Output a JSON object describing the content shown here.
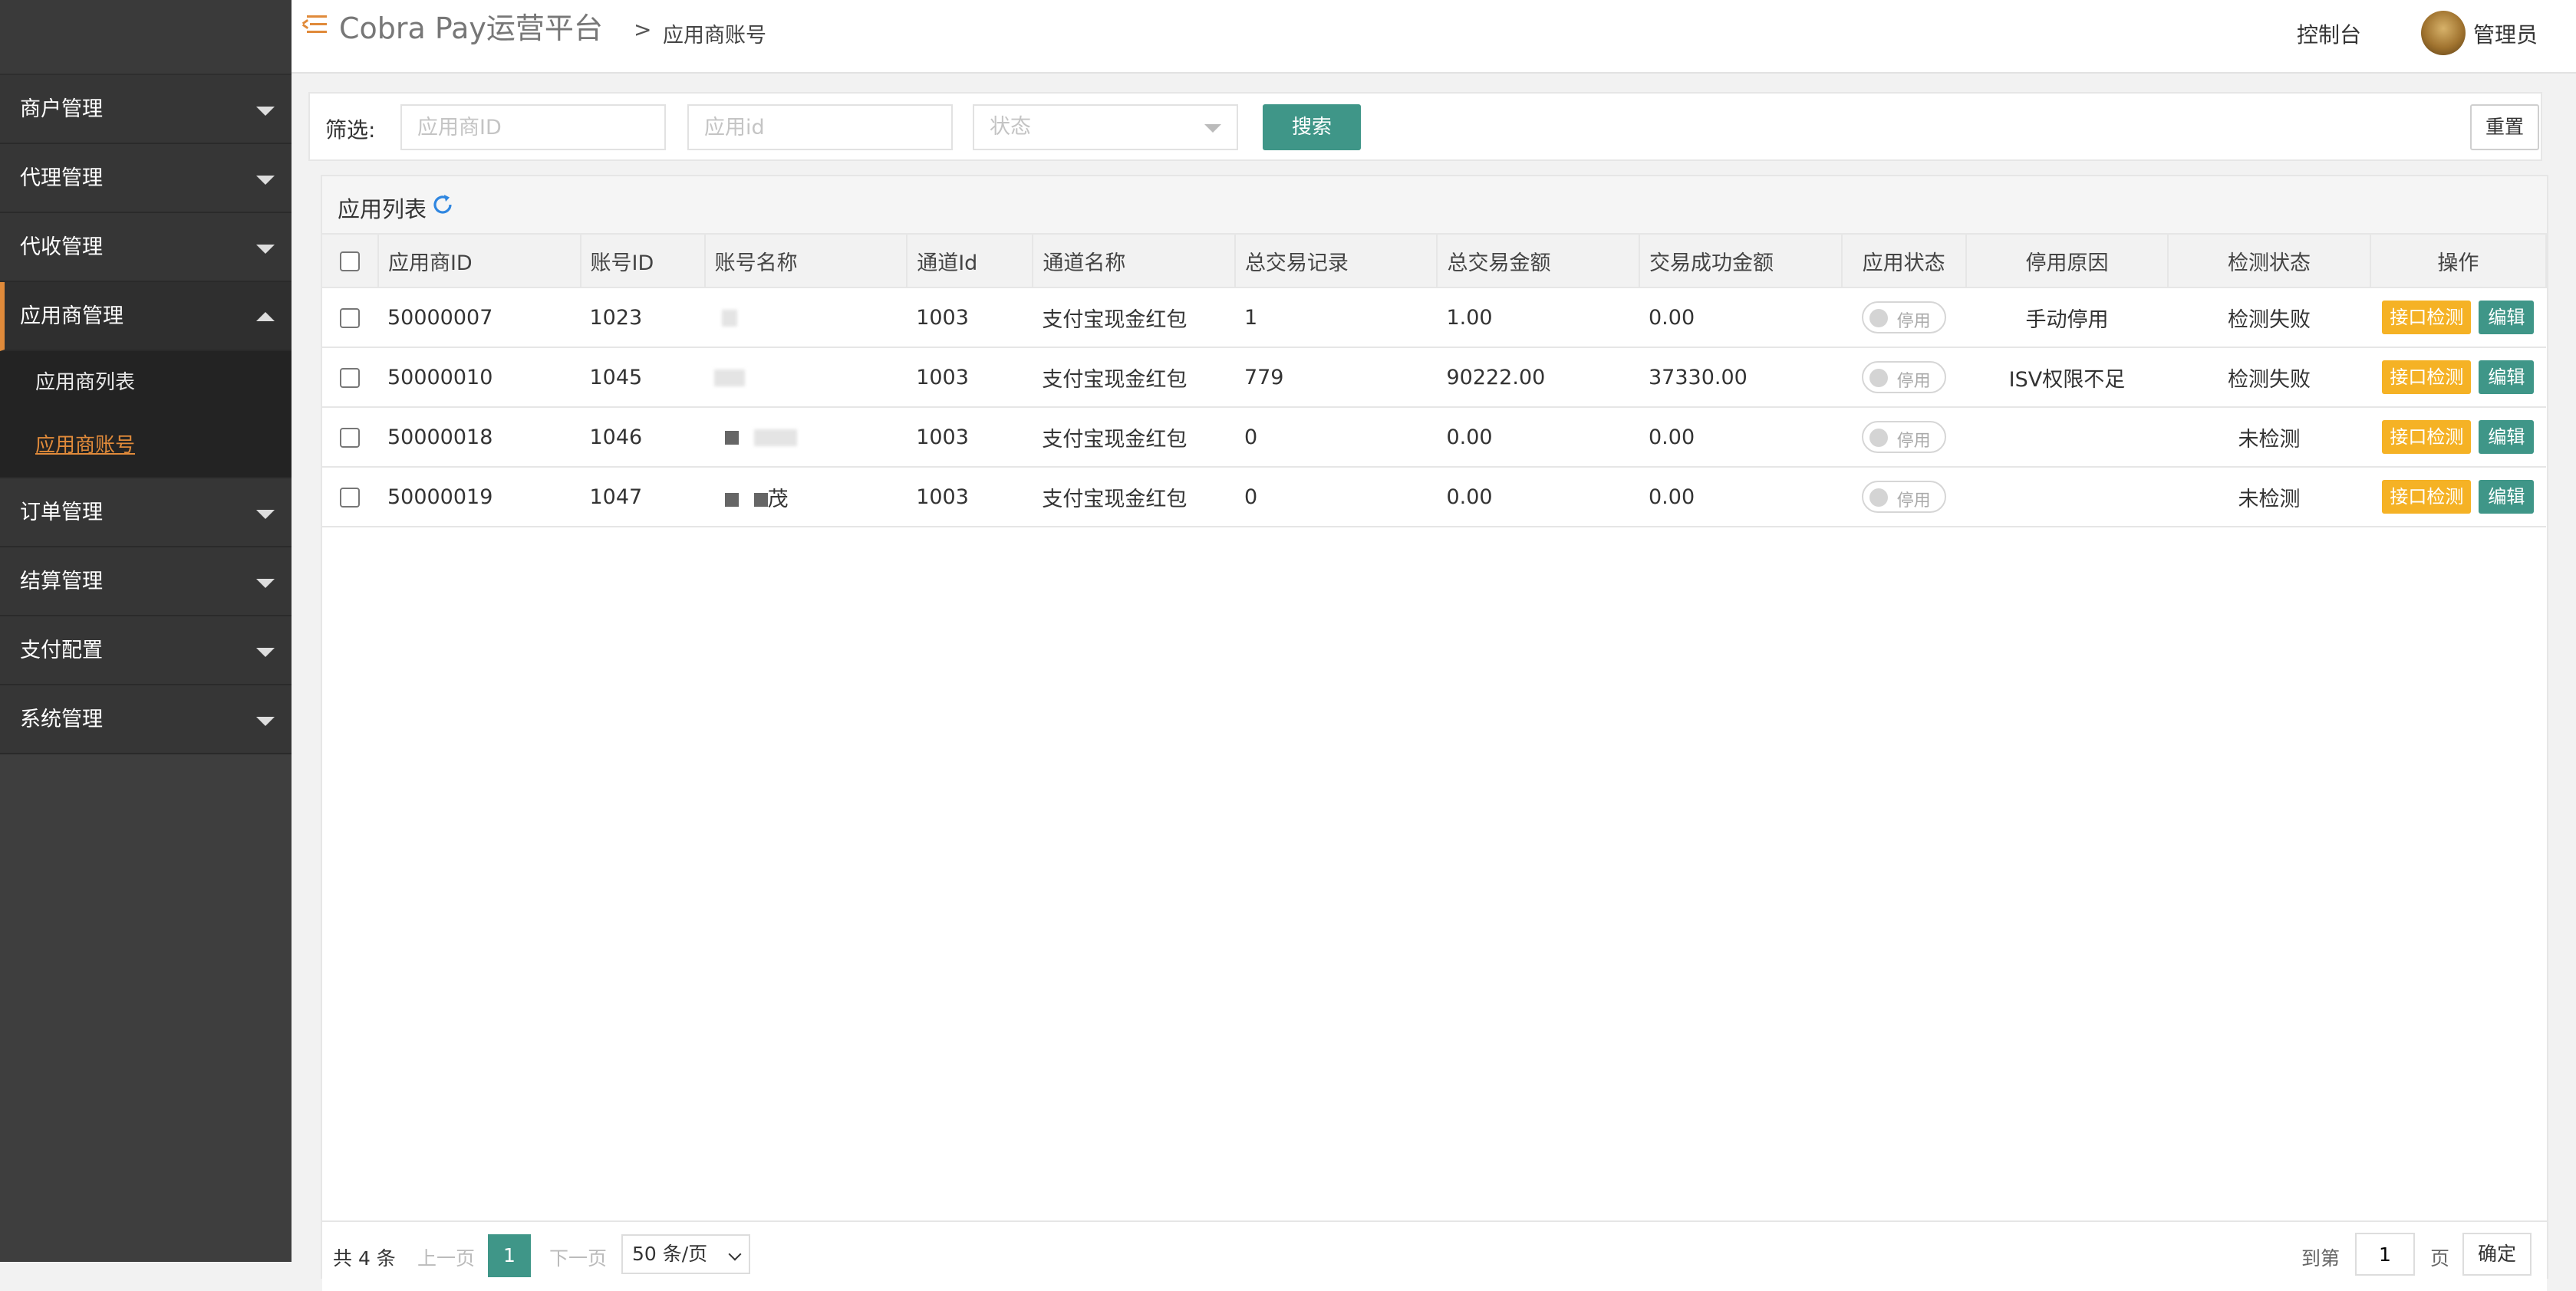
{
  "sidebar": {
    "menus": [
      {
        "label": "商户管理"
      },
      {
        "label": "代理管理"
      },
      {
        "label": "代收管理"
      },
      {
        "label": "应用商管理",
        "sub": [
          "应用商列表",
          "应用商账号"
        ]
      },
      {
        "label": "订单管理"
      },
      {
        "label": "结算管理"
      },
      {
        "label": "支付配置"
      },
      {
        "label": "系统管理"
      }
    ]
  },
  "header": {
    "title": "Cobra Pay运营平台",
    "breadcrumb_sep": ">",
    "breadcrumb": "应用商账号",
    "console": "控制台",
    "user": "管理员"
  },
  "filter": {
    "label": "筛选:",
    "vendor_id_placeholder": "应用商ID",
    "app_id_placeholder": "应用id",
    "status_placeholder": "状态",
    "search": "搜索",
    "reset": "重置"
  },
  "panel": {
    "title": "应用列表"
  },
  "table": {
    "headers": [
      "应用商ID",
      "账号ID",
      "账号名称",
      "通道Id",
      "通道名称",
      "总交易记录",
      "总交易金额",
      "交易成功金额",
      "应用状态",
      "停用原因",
      "检测状态",
      "操作"
    ],
    "rows": [
      {
        "vendor_id": "50000007",
        "account_id": "1023",
        "name_visible": "",
        "channel_id": "1003",
        "channel_name": "支付宝现金红包",
        "tx_count": "1",
        "tx_amount": "1.00",
        "success_amount": "0.00",
        "status": "停用",
        "reason": "手动停用",
        "check": "检测失败",
        "check_state": "fail",
        "btn_check": "接口检测",
        "btn_edit": "编辑"
      },
      {
        "vendor_id": "50000010",
        "account_id": "1045",
        "name_visible": "",
        "channel_id": "1003",
        "channel_name": "支付宝现金红包",
        "tx_count": "779",
        "tx_amount": "90222.00",
        "success_amount": "37330.00",
        "status": "停用",
        "reason": "ISV权限不足",
        "check": "检测失败",
        "check_state": "fail",
        "btn_check": "接口检测",
        "btn_edit": "编辑"
      },
      {
        "vendor_id": "50000018",
        "account_id": "1046",
        "name_visible": "",
        "channel_id": "1003",
        "channel_name": "支付宝现金红包",
        "tx_count": "0",
        "tx_amount": "0.00",
        "success_amount": "0.00",
        "status": "停用",
        "reason": "",
        "check": "未检测",
        "check_state": "none",
        "btn_check": "接口检测",
        "btn_edit": "编辑"
      },
      {
        "vendor_id": "50000019",
        "account_id": "1047",
        "name_visible": "茂",
        "channel_id": "1003",
        "channel_name": "支付宝现金红包",
        "tx_count": "0",
        "tx_amount": "0.00",
        "success_amount": "0.00",
        "status": "停用",
        "reason": "",
        "check": "未检测",
        "check_state": "none",
        "btn_check": "接口检测",
        "btn_edit": "编辑"
      }
    ]
  },
  "pager": {
    "total": "共 4 条",
    "prev": "上一页",
    "current": "1",
    "next": "下一页",
    "page_size": "50 条/页",
    "goto": "到第",
    "goto_value": "1",
    "page": "页",
    "confirm": "确定"
  },
  "colors": {
    "primary": "#3f9688",
    "accent": "#e08a3a",
    "warning": "#f5b225",
    "fail": "#e06a5a"
  }
}
